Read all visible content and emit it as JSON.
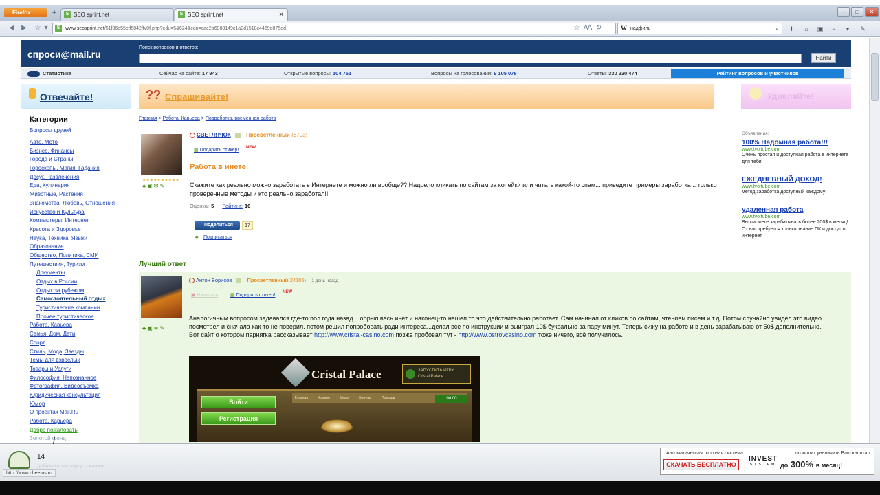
{
  "browser": {
    "app_button": "Firefox",
    "new_tab_icon": "+",
    "tabs": [
      {
        "label": "SEO sprint.net",
        "favicon": "S"
      },
      {
        "label": "SEO sprint.net",
        "favicon": "S"
      }
    ],
    "url_prefix": "www.seosprint.net",
    "url_rest": "/51f86e55ctf5842ffv0f.php?edu=5&624&con=cae2a6988149c1a0d1518c4469d875ed",
    "search_value": "надфиль",
    "search_engine": "W"
  },
  "header": {
    "logo_pre": "спроси",
    "logo_at": "@",
    "logo_post": "mail.ru",
    "search_label": "Поиск вопросов и ответов:",
    "search_value": "",
    "search_button": "Найти"
  },
  "stats": {
    "label": "Статистика",
    "online_label": "Сейчас на сайте:",
    "online_value": "17 943",
    "open_label": "Открытые вопросы:",
    "open_value": "104 751",
    "voting_label": "Вопросы на голосовании:",
    "voting_value": "9 105 078",
    "answers_label": "Ответы:",
    "answers_value": "330 230 474",
    "rating_pre": "Рейтинг",
    "rating_q": "вопросов",
    "rating_and": "и",
    "rating_users": "участников"
  },
  "banners": {
    "answer": "Отвечайте!",
    "ask": "Спрашивайте!",
    "wonder": "Удивляйте!"
  },
  "sidebar": {
    "title": "Категории",
    "friends": "Вопросы друзей",
    "items": [
      {
        "label": "Авто, Мото",
        "sub": false
      },
      {
        "label": "Бизнес, Финансы",
        "sub": false
      },
      {
        "label": "Города и Страны",
        "sub": false
      },
      {
        "label": "Гороскопы, Магия, Гадания",
        "sub": false
      },
      {
        "label": "Досуг, Развлечения",
        "sub": false
      },
      {
        "label": "Еда, Кулинария",
        "sub": false
      },
      {
        "label": "Животные, Растения",
        "sub": false
      },
      {
        "label": "Знакомства, Любовь, Отношения",
        "sub": false
      },
      {
        "label": "Искусство и Культура",
        "sub": false
      },
      {
        "label": "Компьютеры, Интернет",
        "sub": false
      },
      {
        "label": "Красота и Здоровье",
        "sub": false
      },
      {
        "label": "Наука, Техника, Языки",
        "sub": false
      },
      {
        "label": "Образование",
        "sub": false
      },
      {
        "label": "Общество, Политика, СМИ",
        "sub": false
      },
      {
        "label": "Путешествия, Туризм",
        "sub": false
      },
      {
        "label": "Документы",
        "sub": true
      },
      {
        "label": "Отдых в России",
        "sub": true
      },
      {
        "label": "Отдых за рубежом",
        "sub": true
      },
      {
        "label": "Самостоятельный отдых",
        "sub": true,
        "current": true
      },
      {
        "label": "Туристические компании",
        "sub": true
      },
      {
        "label": "Прочее туристическое",
        "sub": true
      },
      {
        "label": "Работа, Карьера",
        "sub": false
      },
      {
        "label": "Семья, Дом, Дети",
        "sub": false
      },
      {
        "label": "Спорт",
        "sub": false
      },
      {
        "label": "Стиль, Мода, Звезды",
        "sub": false
      },
      {
        "label": "Темы для взрослых",
        "sub": false
      },
      {
        "label": "Товары и Услуги",
        "sub": false
      },
      {
        "label": "Философия, Непознанное",
        "sub": false
      },
      {
        "label": "Фотография, Видеосъемка",
        "sub": false
      },
      {
        "label": "Юридическая консультация",
        "sub": false
      },
      {
        "label": "Юмор",
        "sub": false
      },
      {
        "label": "О проектах Mail.Ru",
        "sub": false
      },
      {
        "label": "Работа, Карьера",
        "sub": false
      },
      {
        "label": "Добро пожаловать",
        "sub": false,
        "green": true
      },
      {
        "label": "Золотой фонд",
        "sub": false,
        "fade": true
      }
    ]
  },
  "breadcrumb": [
    "Главная",
    "Работа, Карьера",
    "Подработка, временная работа"
  ],
  "question": {
    "user": "СВЕТЛЯЧОК",
    "level": "Просветленный",
    "points": "(8703)",
    "sticker": "Подарить стикер!",
    "new_tag": "NEW",
    "title": "Работа в инете",
    "text": "Скажите как реально можно заработать в Интернете и можно ли вообще?? Надоело кликать по сайтам за копейки или читать какой-то спам...   приведите примеры заработка .. только проверенные методы и кто реально заработал!!!",
    "score_label": "Оценка:",
    "score": "5",
    "rating_label": "Рейтинг:",
    "rating": "10",
    "share": "Поделиться",
    "share_count": "17",
    "subscribe": "Подписаться"
  },
  "ads": {
    "label": "Объявления:",
    "items": [
      {
        "head": "100% Надомная работа!!!",
        "url": "www.tvoitube.com",
        "desc": "Очень простая и доступная работа в интернете для тебя!"
      },
      {
        "head": "ЕЖЕДНЕВНЫЙ ДОХОД!",
        "url": "www.tvoitube.com",
        "desc": "метод заработка доступный каждому!"
      },
      {
        "head": "удаленная работа",
        "url": "www.tvoitube.com",
        "desc": "Вы сможете зарабатывать более 200$ в месяц! От вас требуется только знание ПК и доступ в интернет."
      }
    ]
  },
  "best_answer": {
    "title": "Лучший ответ",
    "user": "Антон Борисов",
    "level": "Просветленный",
    "points": "(24106)",
    "ago": "1 день назад",
    "sticker": "Подарить стикер!",
    "new_tag": "NEW",
    "faded_link": "Написать",
    "text1": "Аналогичным вопросом задавался где-то пол года назад... обрыл весь инет и наконец-то нашел то что действительно работает. Сам начинал от кликов по сайтам, чтением писем и т.д. Потом случайно увидел это видео посмотрел и сначала как-то не поверил. потом решил попробовать ради интереса...делал все по инструкции и выиграл 10$ буквально за пару минут. Теперь сижу на работе и в день зарабатываю от 50$ дополнительно.",
    "text2_pre": "Вот сайт о котором парнягка рассказывает",
    "link1": "http://www.cristal-casino.com",
    "text2_mid": "позже пробовал тут -",
    "link2": "http://www.ostrovcasino.com",
    "text2_post": "тоже ничего, всё получилось."
  },
  "casino": {
    "title": "Cristal Palace",
    "badge_line1": "ЗАПУСТИТЬ ИГРУ",
    "badge_line2": "Cristal Palace",
    "btn1": "Войти",
    "btn2": "Регистрация",
    "nav": "Главная Казино Игры Бонусы Помощь",
    "counter": "00:00"
  },
  "bottom": {
    "count": "14",
    "faint_text": "добавить закладку · скачать",
    "status_url": "http://www.cheetus.ru",
    "ad_line1": "Автоматическая торговая система",
    "ad_download": "СКАЧАТЬ БЕСПЛАТНО",
    "ad_logo": "INVEST",
    "ad_logo_sub": "SYSTEM",
    "ad_right1": "позволит увеличить  Ваш капитал",
    "ad_right2_pre": "до",
    "ad_right2_pct": "300%",
    "ad_right2_post": "в месяц!"
  },
  "colors": {
    "header_bg": "#1a3f73",
    "link": "#1a3fb0",
    "orange": "#e8891f",
    "answer_bg": "#ebf7e3"
  }
}
